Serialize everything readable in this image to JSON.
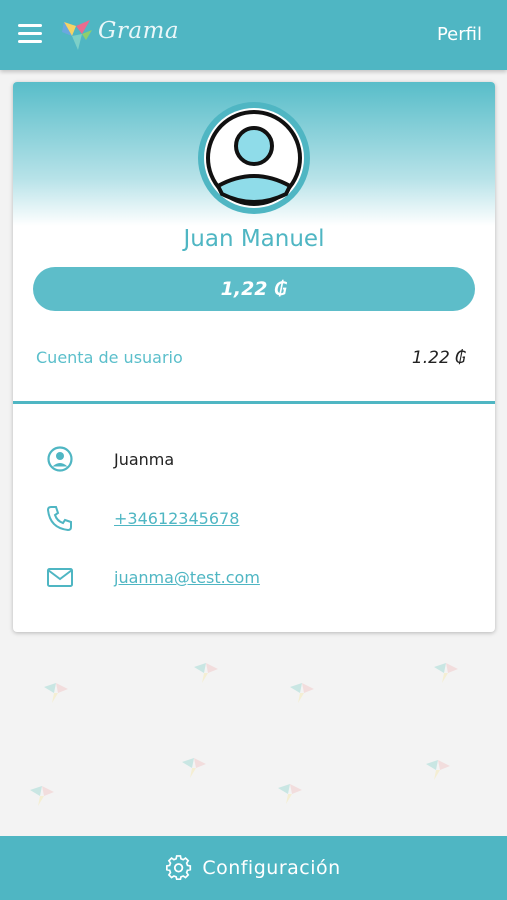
{
  "header": {
    "brand": "Grama",
    "title": "Perfil"
  },
  "profile": {
    "name": "Juan Manuel",
    "balance": "1,22 ₲",
    "account_label": "Cuenta de usuario",
    "account_value": "1.22 ₲",
    "username": "Juanma",
    "phone": "+34612345678",
    "email": "juanma@test.com"
  },
  "footer": {
    "settings_label": "Configuración"
  },
  "colors": {
    "primary": "#4fb6c3",
    "background": "#f3f3f3",
    "card": "#ffffff"
  },
  "icons": [
    "menu-icon",
    "grama-logo-icon",
    "user-circle-icon",
    "phone-icon",
    "mail-icon",
    "gear-icon"
  ]
}
